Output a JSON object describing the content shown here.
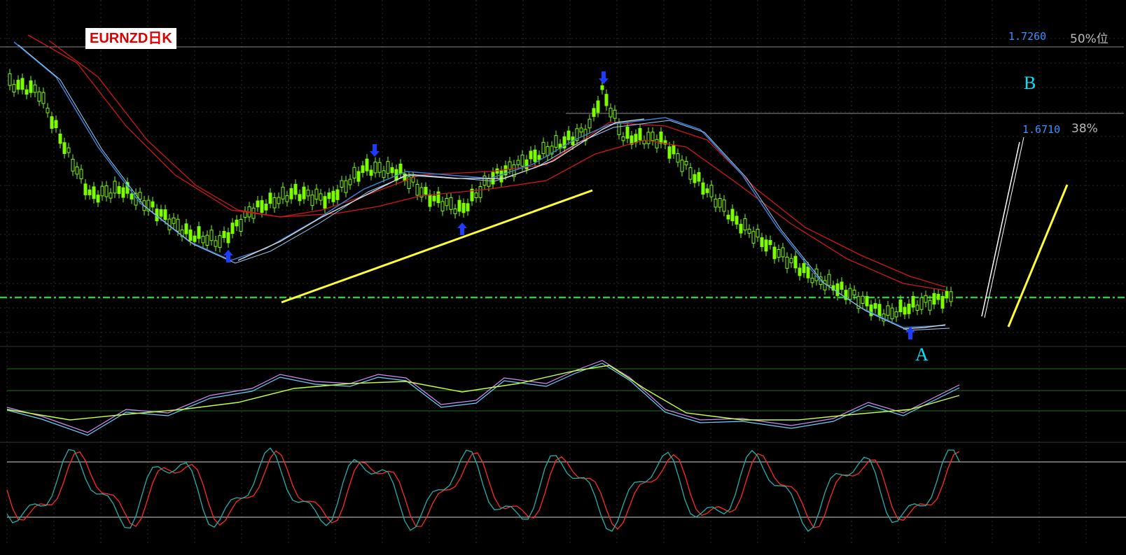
{
  "title": "EURNZD日K",
  "levels": [
    {
      "price": "1.7260",
      "label": "50%位"
    },
    {
      "price": "1.6710",
      "label": "38%"
    }
  ],
  "points": {
    "a": "A",
    "b": "B"
  },
  "colors": {
    "background": "#000000",
    "bull_candle": "#7CFC00",
    "bear_candle": "#7CFC00",
    "ma_red": "#d01818",
    "ma_blue": "#3a7fd5",
    "ma_white": "#e0e0e0",
    "trendline": "#ffff33",
    "support": "#2ecc40",
    "arrow": "#1a3dff",
    "osc_signal": "#ff2a2a",
    "osc_main": "#20b2aa"
  },
  "chart_data": {
    "type": "candlestick",
    "symbol": "EURNZD",
    "timeframe": "D1",
    "approx_price_range": [
      1.52,
      1.74
    ],
    "support_level_y": 1.585,
    "fib_levels": [
      {
        "ratio": "50%",
        "price": 1.726
      },
      {
        "ratio": "38%",
        "price": 1.671
      }
    ],
    "annotations": [
      "A",
      "B"
    ],
    "indicator_panels": [
      "macd-style",
      "stochastic-style"
    ]
  }
}
